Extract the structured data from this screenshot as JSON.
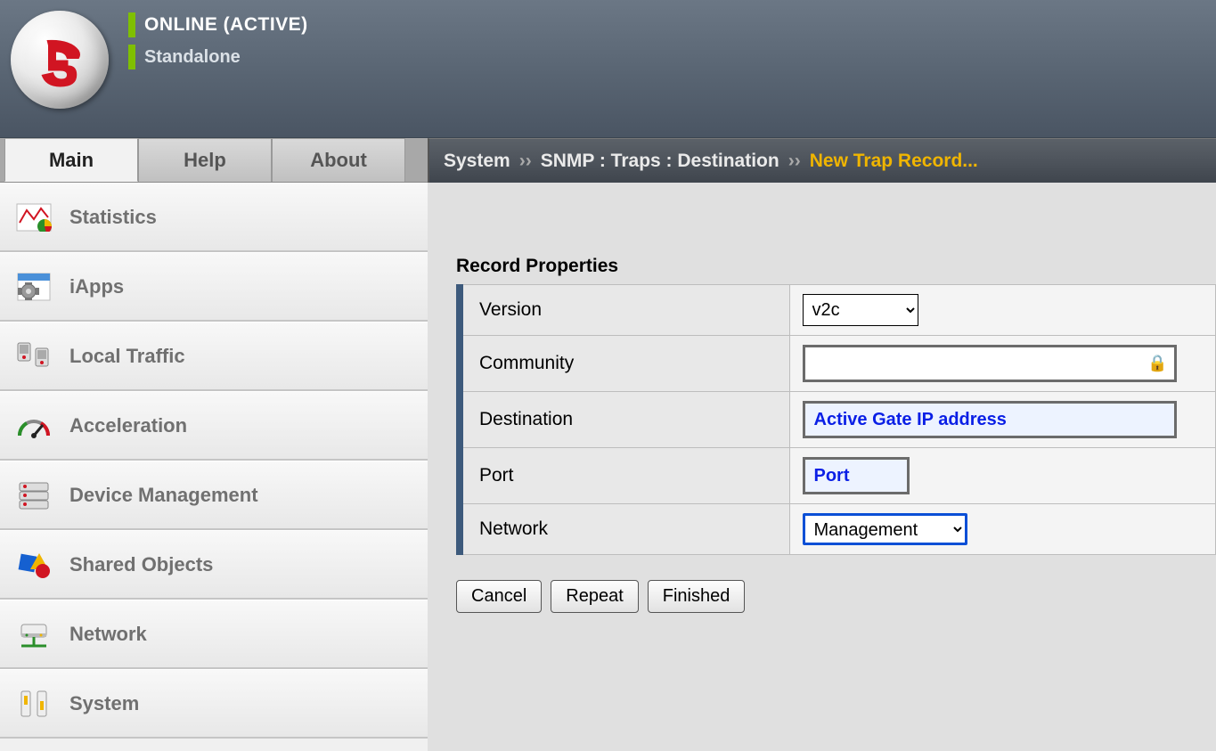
{
  "header": {
    "status": "ONLINE (ACTIVE)",
    "mode": "Standalone"
  },
  "tabs": {
    "main": "Main",
    "help": "Help",
    "about": "About"
  },
  "nav": {
    "statistics": "Statistics",
    "iapps": "iApps",
    "local_traffic": "Local Traffic",
    "acceleration": "Acceleration",
    "device_management": "Device Management",
    "shared_objects": "Shared Objects",
    "network": "Network",
    "system": "System"
  },
  "breadcrumb": {
    "root": "System",
    "sep1": "››",
    "path": "SNMP : Traps : Destination",
    "sep2": "››",
    "current": "New Trap Record..."
  },
  "section": {
    "title": "Record Properties"
  },
  "form": {
    "version_label": "Version",
    "version_value": "v2c",
    "community_label": "Community",
    "community_value": "",
    "destination_label": "Destination",
    "destination_value": "Active Gate IP address",
    "port_label": "Port",
    "port_value": "Port",
    "network_label": "Network",
    "network_value": "Management"
  },
  "buttons": {
    "cancel": "Cancel",
    "repeat": "Repeat",
    "finished": "Finished"
  }
}
